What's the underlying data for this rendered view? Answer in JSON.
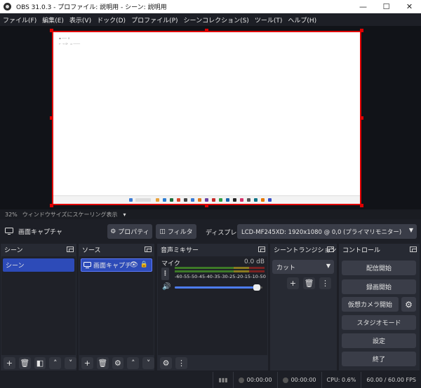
{
  "window": {
    "title": "OBS 31.0.3 - プロファイル: 説明用 - シーン: 説明用",
    "minimize": "—",
    "maximize": "☐",
    "close": "✕"
  },
  "menu": [
    "ファイル(F)",
    "編集(E)",
    "表示(V)",
    "ドック(D)",
    "プロファイル(P)",
    "シーンコレクション(S)",
    "ツール(T)",
    "ヘルプ(H)"
  ],
  "preview": {
    "zoom": "32%",
    "scaling": "ウィンドウサイズにスケーリング表示",
    "zoom_arrow": "▾"
  },
  "source_toolbar": {
    "current_source": "画面キャプチャ",
    "properties": "プロパティ",
    "filters": "フィルタ",
    "display_label": "ディスプレイ",
    "display_value": "LCD-MF245XD: 1920x1080 @ 0,0 (プライマリモニター)"
  },
  "docks": {
    "scenes": {
      "title": "シーン",
      "items": [
        "シーン"
      ]
    },
    "sources": {
      "title": "ソース",
      "items": [
        "画面キャプチ"
      ]
    },
    "mixer": {
      "title": "音声ミキサー",
      "channel": "マイク",
      "level": "0.0 dB",
      "scale": [
        "-60",
        "-55",
        "-50",
        "-45",
        "-40",
        "-35",
        "-30",
        "-25",
        "-20",
        "-15",
        "-10",
        "-5",
        "0"
      ],
      "volume": 0.96
    },
    "transitions": {
      "title": "シーントランジション",
      "selected": "カット"
    },
    "controls": {
      "title": "コントロール",
      "buttons": [
        "配信開始",
        "録画開始",
        "仮想カメラ開始",
        "スタジオモード",
        "設定",
        "終了"
      ]
    }
  },
  "status": {
    "stream_time": "00:00:00",
    "record_time": "00:00:00",
    "cpu": "CPU: 0.6%",
    "fps": "60.00 / 60.00 FPS"
  }
}
